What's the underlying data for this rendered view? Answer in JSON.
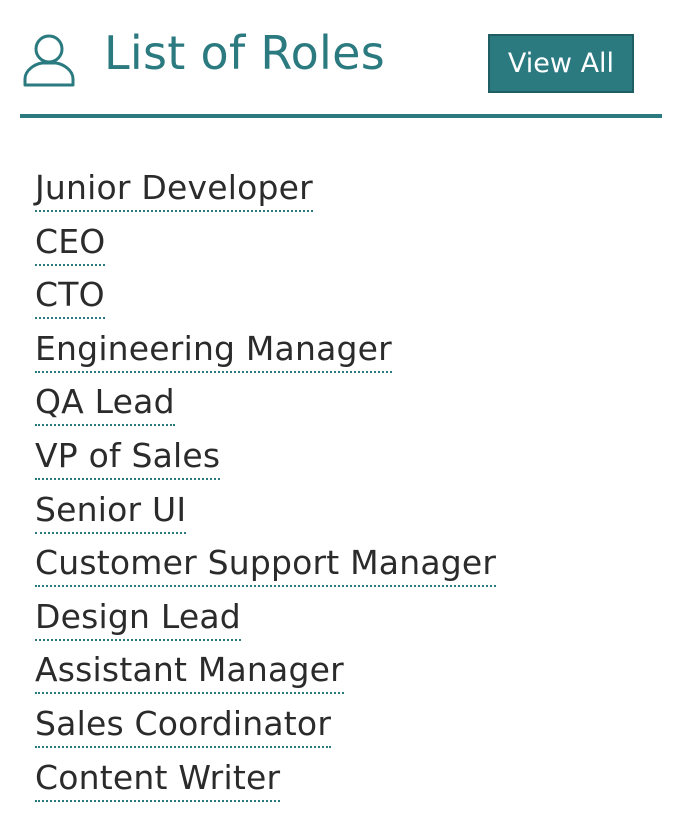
{
  "header": {
    "icon": "user-icon",
    "title": "List of Roles",
    "view_all_label": "View All"
  },
  "roles": [
    "Junior Developer",
    "CEO",
    "CTO",
    "Engineering Manager",
    "QA Lead",
    "VP of Sales",
    "Senior UI",
    "Customer Support Manager",
    "Design Lead",
    "Assistant Manager",
    "Sales Coordinator",
    "Content Writer"
  ],
  "colors": {
    "accent": "#2b7a80",
    "text": "#2b2b2b",
    "background": "#ffffff"
  }
}
